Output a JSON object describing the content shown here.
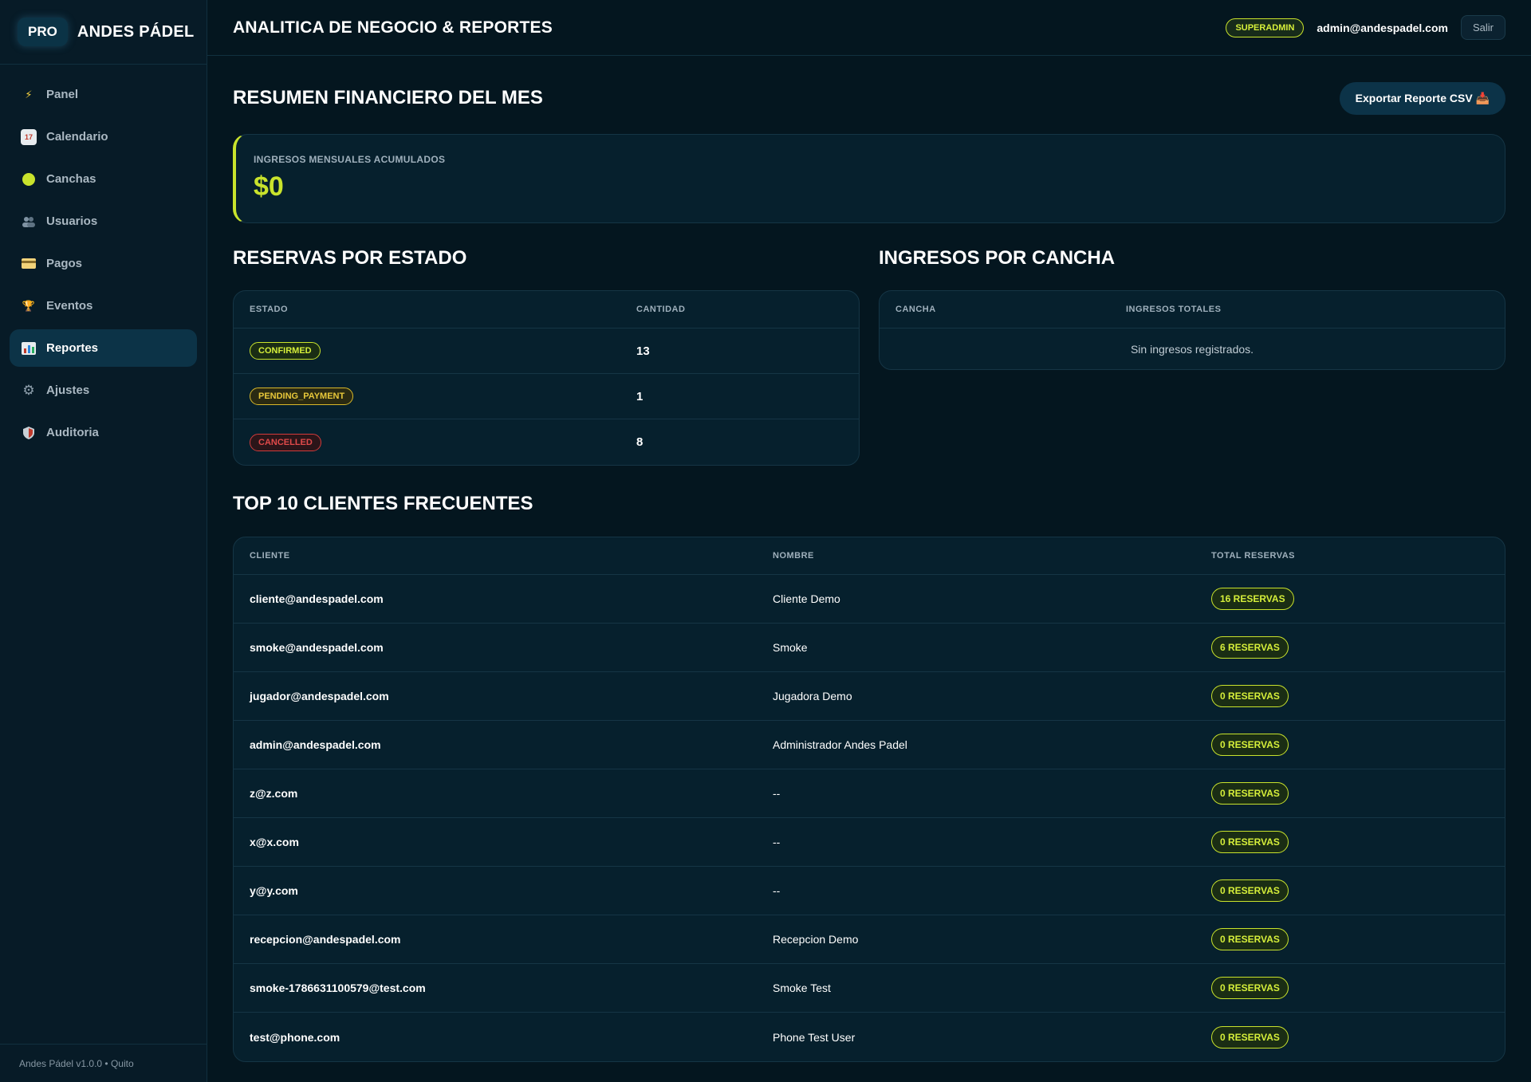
{
  "brand": {
    "pro_label": "PRO",
    "name": "ANDES PÁDEL"
  },
  "sidebar": {
    "items": [
      {
        "label": "Panel",
        "icon": "lightning-icon",
        "active": false
      },
      {
        "label": "Calendario",
        "icon": "calendar-icon",
        "active": false
      },
      {
        "label": "Canchas",
        "icon": "tennis-ball-icon",
        "active": false
      },
      {
        "label": "Usuarios",
        "icon": "users-icon",
        "active": false
      },
      {
        "label": "Pagos",
        "icon": "credit-card-icon",
        "active": false
      },
      {
        "label": "Eventos",
        "icon": "trophy-icon",
        "active": false
      },
      {
        "label": "Reportes",
        "icon": "bar-chart-icon",
        "active": true
      },
      {
        "label": "Ajustes",
        "icon": "gear-icon",
        "active": false
      },
      {
        "label": "Auditoria",
        "icon": "shield-icon",
        "active": false
      }
    ],
    "footer": "Andes Pádel v1.0.0 • Quito"
  },
  "topbar": {
    "title": "ANALITICA DE NEGOCIO & REPORTES",
    "role": "SUPERADMIN",
    "email": "admin@andespadel.com",
    "logout_label": "Salir"
  },
  "financial": {
    "title": "RESUMEN FINANCIERO DEL MES",
    "export_label": "Exportar Reporte CSV 📥",
    "kpi_label": "INGRESOS MENSUALES ACUMULADOS",
    "kpi_value": "$0"
  },
  "status_table": {
    "title": "RESERVAS POR ESTADO",
    "headers": [
      "ESTADO",
      "CANTIDAD"
    ],
    "rows": [
      {
        "status": "CONFIRMED",
        "count": "13"
      },
      {
        "status": "PENDING_PAYMENT",
        "count": "1"
      },
      {
        "status": "CANCELLED",
        "count": "8"
      }
    ]
  },
  "court_table": {
    "title": "INGRESOS POR CANCHA",
    "headers": [
      "CANCHA",
      "INGRESOS TOTALES"
    ],
    "empty": "Sin ingresos registrados."
  },
  "clients_table": {
    "title": "TOP 10 CLIENTES FRECUENTES",
    "headers": [
      "CLIENTE",
      "NOMBRE",
      "TOTAL RESERVAS"
    ],
    "rows": [
      {
        "email": "cliente@andespadel.com",
        "name": "Cliente Demo",
        "total": "16 RESERVAS"
      },
      {
        "email": "smoke@andespadel.com",
        "name": "Smoke",
        "total": "6 RESERVAS"
      },
      {
        "email": "jugador@andespadel.com",
        "name": "Jugadora Demo",
        "total": "0 RESERVAS"
      },
      {
        "email": "admin@andespadel.com",
        "name": "Administrador Andes Padel",
        "total": "0 RESERVAS"
      },
      {
        "email": "z@z.com",
        "name": "--",
        "total": "0 RESERVAS"
      },
      {
        "email": "x@x.com",
        "name": "--",
        "total": "0 RESERVAS"
      },
      {
        "email": "y@y.com",
        "name": "--",
        "total": "0 RESERVAS"
      },
      {
        "email": "recepcion@andespadel.com",
        "name": "Recepcion Demo",
        "total": "0 RESERVAS"
      },
      {
        "email": "smoke-1786631100579@test.com",
        "name": "Smoke Test",
        "total": "0 RESERVAS"
      },
      {
        "email": "test@phone.com",
        "name": "Phone Test User",
        "total": "0 RESERVAS"
      }
    ]
  },
  "colors": {
    "background": "#04161f",
    "sidebar": "#071b27",
    "accent": "#c9e32c",
    "pending": "#e8c83a",
    "cancelled": "#e04a4a"
  }
}
